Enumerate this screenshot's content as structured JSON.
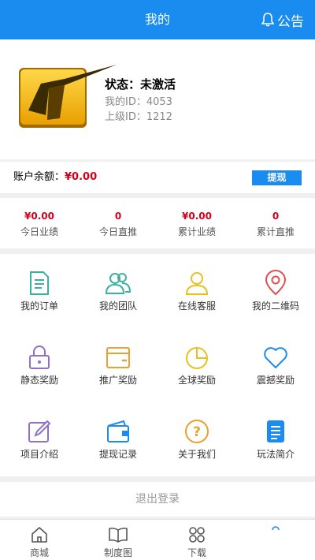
{
  "header": {
    "title": "我的",
    "notice_label": "公告"
  },
  "profile": {
    "status_label": "状态：",
    "status_value": "未激活",
    "my_id_label": "我的ID：",
    "my_id": "4053",
    "parent_id_label": "上级ID：",
    "parent_id": "1212"
  },
  "balance": {
    "label": "账户余额：",
    "amount": "¥0.00",
    "withdraw_label": "提现"
  },
  "stats": [
    {
      "value": "¥0.00",
      "label": "今日业绩"
    },
    {
      "value": "0",
      "label": "今日直推"
    },
    {
      "value": "¥0.00",
      "label": "累计业绩"
    },
    {
      "value": "0",
      "label": "累计直推"
    }
  ],
  "menu": [
    {
      "label": "我的订单",
      "icon": "order-icon",
      "color": "#3cb0a0"
    },
    {
      "label": "我的团队",
      "icon": "team-icon",
      "color": "#3cb0a0"
    },
    {
      "label": "在线客服",
      "icon": "service-icon",
      "color": "#e8c020"
    },
    {
      "label": "我的二维码",
      "icon": "location-pin-icon",
      "color": "#e05050"
    },
    {
      "label": "静态奖励",
      "icon": "lock-icon",
      "color": "#9070c8"
    },
    {
      "label": "推广奖励",
      "icon": "wallet-card-icon",
      "color": "#e8a030"
    },
    {
      "label": "全球奖励",
      "icon": "pie-chart-icon",
      "color": "#e8c020"
    },
    {
      "label": "震撼奖励",
      "icon": "heart-icon",
      "color": "#1a8cf0"
    },
    {
      "label": "项目介绍",
      "icon": "edit-icon",
      "color": "#9070c8"
    },
    {
      "label": "提现记录",
      "icon": "wallet-icon",
      "color": "#1a8cf0"
    },
    {
      "label": "关于我们",
      "icon": "question-icon",
      "color": "#e8a030"
    },
    {
      "label": "玩法简介",
      "icon": "document-icon",
      "color": "#1a8cf0"
    }
  ],
  "logout_label": "退出登录",
  "tabbar": [
    {
      "label": "商城",
      "icon": "home-icon"
    },
    {
      "label": "制度图",
      "icon": "book-icon"
    },
    {
      "label": "下载",
      "icon": "download-icon"
    },
    {
      "label": "",
      "icon": "profile-icon"
    }
  ],
  "colors": {
    "primary": "#1a8cf0",
    "money": "#d0021b"
  }
}
